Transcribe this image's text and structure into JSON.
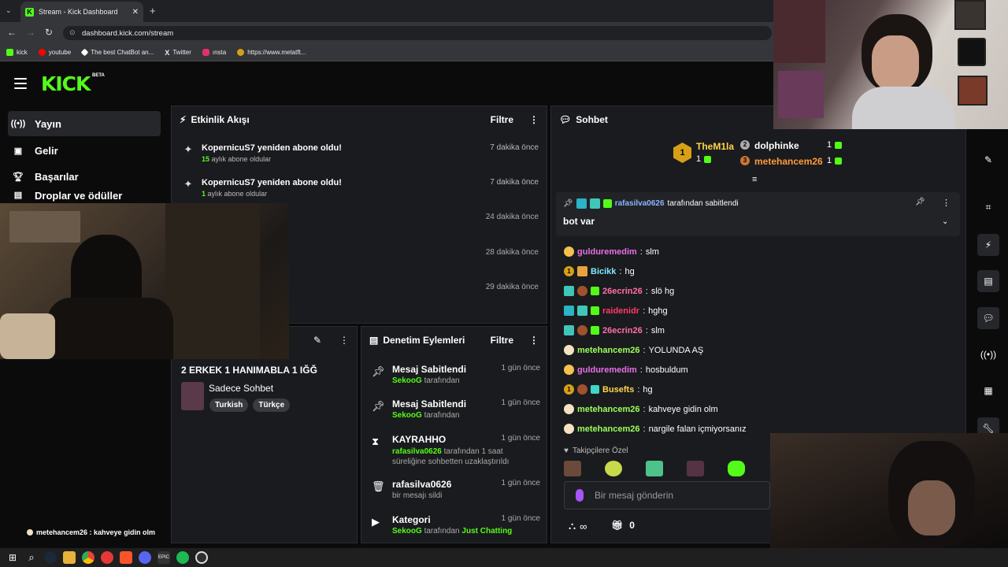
{
  "browser": {
    "tab_title": "Stream - Kick Dashboard",
    "url": "dashboard.kick.com/stream",
    "bookmarks": [
      {
        "label": "kick",
        "color": "#53fc18"
      },
      {
        "label": "youtube",
        "color": "#ff0000"
      },
      {
        "label": "The best ChatBot an...",
        "color": "#ffffff"
      },
      {
        "label": "Twitter",
        "color": "#ffffff"
      },
      {
        "label": "ınsta",
        "color": "#e1306c"
      },
      {
        "label": "https://www.metatft...",
        "color": "#d4a017"
      }
    ]
  },
  "header": {
    "logo": "KICK",
    "beta": "BETA"
  },
  "sidebar": {
    "items": [
      {
        "label": "Yayın",
        "icon": "broadcast-icon"
      },
      {
        "label": "Gelir",
        "icon": "revenue-icon"
      },
      {
        "label": "Başarılar",
        "icon": "trophy-icon"
      },
      {
        "label": "Droplar ve ödüller",
        "icon": "gift-icon"
      }
    ],
    "overlay_chat": "metehancem26 : kahveye gidin olm"
  },
  "activity": {
    "title": "Etkinlik Akışı",
    "filter": "Filtre",
    "items": [
      {
        "title": "KopernicuS7 yeniden abone oldu!",
        "num": "15",
        "sub": "aylık abone oldular",
        "time": "7 dakika önce"
      },
      {
        "title": "KopernicuS7 yeniden abone oldu!",
        "num": "1",
        "sub": "aylık abone oldular",
        "time": "7 dakika önce"
      },
      {
        "time": "24 dakika önce"
      },
      {
        "time": "28 dakika önce"
      },
      {
        "time": "29 dakika önce"
      }
    ]
  },
  "stream_info": {
    "title": "2 ERKEK 1 HANIMABLA 1 IĞĞ",
    "category": "Sadece Sohbet",
    "tags": [
      "Turkish",
      "Türkçe"
    ]
  },
  "moderation": {
    "title": "Denetim Eylemleri",
    "filter": "Filtre",
    "items": [
      {
        "title": "Mesaj Sabitlendi",
        "user": "SekooG",
        "sub": "tarafından",
        "time": "1 gün önce"
      },
      {
        "title": "Mesaj Sabitlendi",
        "user": "SekooG",
        "sub": "tarafından",
        "time": "1 gün önce"
      },
      {
        "title": "KAYRAHHO",
        "user": "rafasilva0626",
        "sub": "tarafından 1 saat süreliğine sohbetten uzaklaştırıldı",
        "time": "1 gün önce"
      },
      {
        "title": "rafasilva0626",
        "user": "",
        "sub": "bir mesajı sildi",
        "time": "1 gün önce"
      },
      {
        "title": "Kategori",
        "user": "SekooG",
        "sub": "tarafından",
        "extra": "Just Chatting",
        "time": "1 gün önce"
      }
    ]
  },
  "chat": {
    "title": "Sohbet",
    "top_gifters": [
      {
        "name": "TheM1la",
        "count": "1",
        "rank": "1"
      },
      {
        "name": "dolphinke",
        "count": "1",
        "rank": "2"
      },
      {
        "name": "metehancem26",
        "count": "1",
        "rank": "3"
      }
    ],
    "pinned": {
      "user": "rafasilva0626",
      "text": "tarafından sabitlendi",
      "message": "bot var"
    },
    "messages": [
      {
        "user": "gulduremedim",
        "text": "slm",
        "color": "#e76fe7"
      },
      {
        "user": "Bicikk",
        "text": "hg",
        "color": "#7fe8ff"
      },
      {
        "user": "26ecrin26",
        "text": "slö hg",
        "color": "#ff6ea8"
      },
      {
        "user": "raidenidr",
        "text": "hghg",
        "color": "#ff3b6b"
      },
      {
        "user": "26ecrin26",
        "text": "slm",
        "color": "#ff6ea8"
      },
      {
        "user": "metehancem26",
        "text": "YOLUNDA AŞ",
        "color": "#9cff5a"
      },
      {
        "user": "gulduremedim",
        "text": "hosbuldum",
        "color": "#e76fe7"
      },
      {
        "user": "Busefts",
        "text": "hg",
        "color": "#ffd54a"
      },
      {
        "user": "metehancem26",
        "text": "kahveye gidin olm",
        "color": "#9cff5a"
      },
      {
        "user": "metehancem26",
        "text": "nargile falan içmiyorsanız",
        "color": "#9cff5a"
      }
    ],
    "followers_only": "Takipçilere Özel",
    "input_placeholder": "Bir mesaj gönderin",
    "gift_count": "0",
    "infinity": "∞"
  },
  "taskbar": {
    "apps": [
      "windows-start",
      "search",
      "steam",
      "file-explorer",
      "chrome",
      "media",
      "brave",
      "discord",
      "epic-games",
      "spotify",
      "obs"
    ]
  }
}
